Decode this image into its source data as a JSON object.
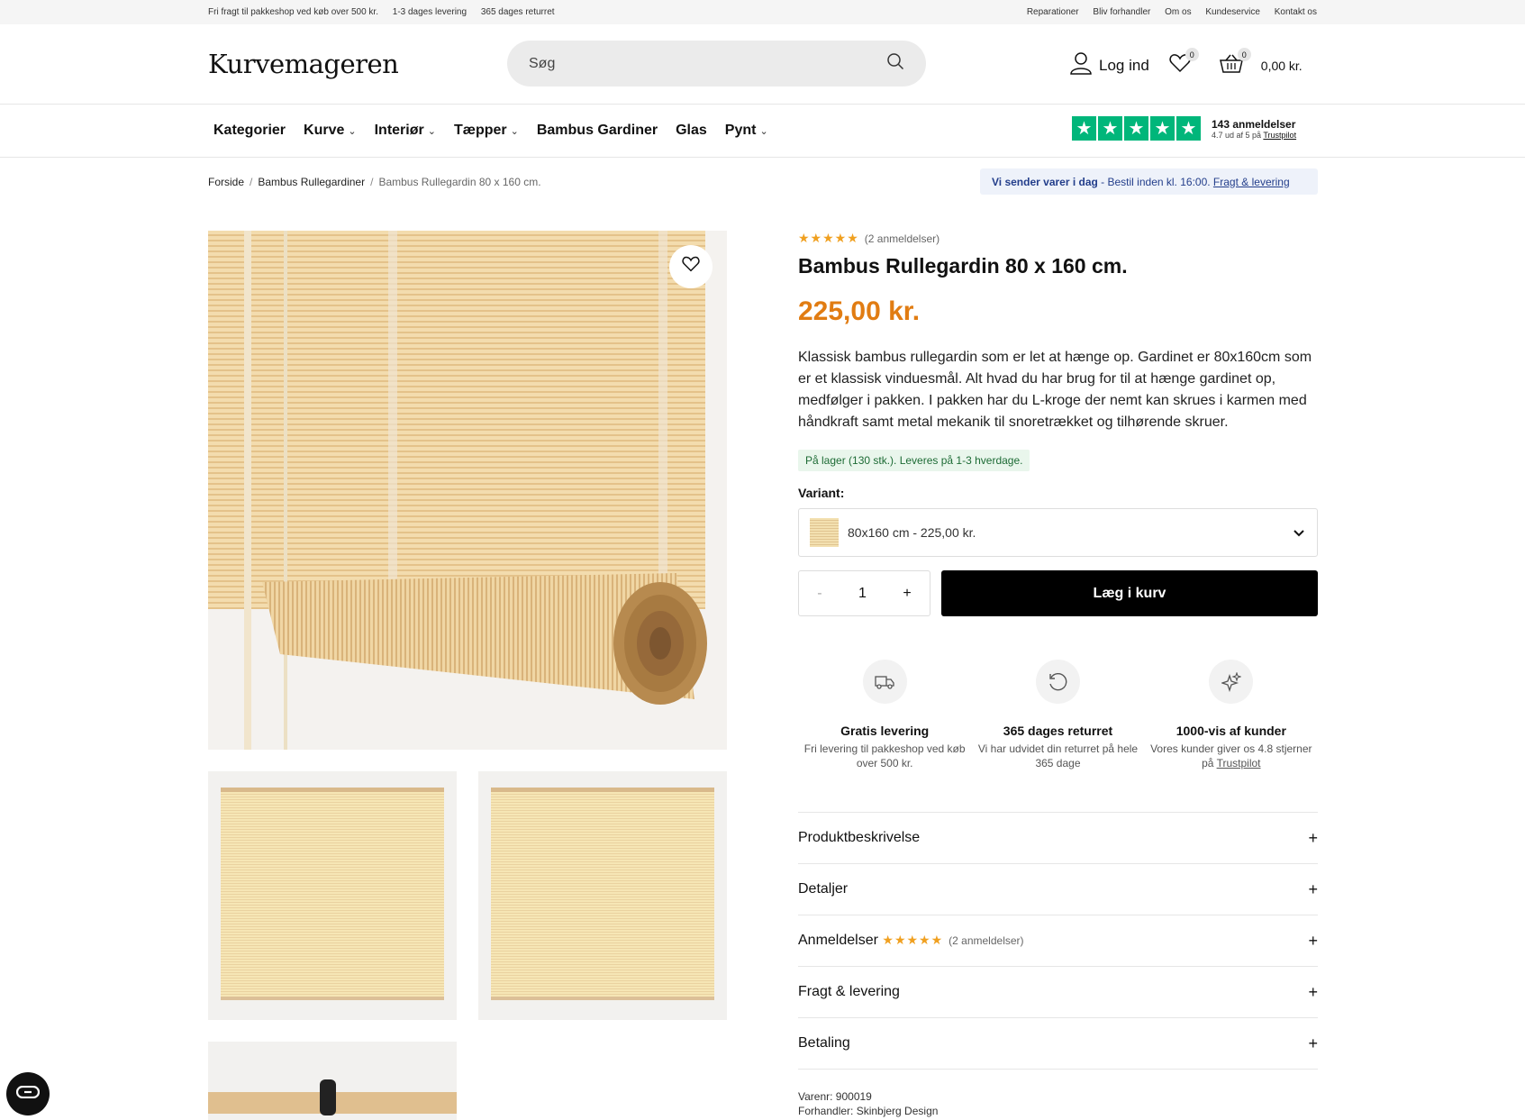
{
  "topbar": {
    "left": [
      "Fri fragt til pakkeshop ved køb over 500 kr.",
      "1-3 dages levering",
      "365 dages returret"
    ],
    "right": [
      "Reparationer",
      "Bliv forhandler",
      "Om os",
      "Kundeservice",
      "Kontakt os"
    ]
  },
  "header": {
    "logo": "Kurvemageren",
    "search_placeholder": "Søg",
    "login": "Log ind",
    "wishlist_count": "0",
    "cart_count": "0",
    "cart_total": "0,00 kr."
  },
  "nav": {
    "items": [
      {
        "label": "Kategorier",
        "chev": ""
      },
      {
        "label": "Kurve",
        "chev": "⌄"
      },
      {
        "label": "Interiør",
        "chev": "⌄"
      },
      {
        "label": "Tæpper",
        "chev": "⌄"
      },
      {
        "label": "Bambus Gardiner",
        "chev": ""
      },
      {
        "label": "Glas",
        "chev": ""
      },
      {
        "label": "Pynt",
        "chev": "⌄"
      }
    ],
    "trustpilot": {
      "reviews": "143 anmeldelser",
      "score_text": "4.7 ud af 5 på",
      "link": "Trustpilot"
    }
  },
  "breadcrumb": [
    "Forside",
    "Bambus Rullegardiner",
    "Bambus Rullegardin 80 x 160 cm."
  ],
  "shipping_notice": {
    "bold": "Vi sender varer i dag",
    "text": " - Bestil inden kl. 16:00. ",
    "link": "Fragt & levering"
  },
  "product": {
    "rating_stars": "★★★★★",
    "review_count": "(2 anmeldelser)",
    "title": "Bambus Rullegardin 80 x 160 cm.",
    "price": "225,00 kr.",
    "description": "Klassisk bambus rullegardin som er let at hænge op. Gardinet er 80x160cm som er et klassisk vinduesmål. Alt hvad du har brug for til at hænge gardinet op, medfølger i pakken. I pakken har du L-kroge der nemt kan skrues i karmen med håndkraft samt metal mekanik til snoretrækket og tilhørende skruer.",
    "stock": "På lager (130 stk.). Leveres på 1-3 hverdage.",
    "variant_label": "Variant:",
    "variant_selected": "80x160 cm - 225,00 kr.",
    "qty_minus": "-",
    "qty": "1",
    "qty_plus": "+",
    "add_to_cart": "Læg i kurv"
  },
  "usps": [
    {
      "title": "Gratis levering",
      "desc": "Fri levering til pakkeshop ved køb over 500 kr.",
      "icon": "truck-icon"
    },
    {
      "title": "365 dages returret",
      "desc": "Vi har udvidet din returret på hele 365 dage",
      "icon": "return-icon"
    },
    {
      "title": "1000-vis af kunder",
      "desc": "Vores kunder giver os 4.8 stjerner på ",
      "link": "Trustpilot",
      "icon": "sparkle-icon"
    }
  ],
  "accordion": [
    {
      "label": "Produktbeskrivelse"
    },
    {
      "label": "Detaljer"
    },
    {
      "label": "Anmeldelser",
      "stars": "★★★★★",
      "count": "(2 anmeldelser)"
    },
    {
      "label": "Fragt & levering"
    },
    {
      "label": "Betaling"
    }
  ],
  "meta": {
    "sku": "Varenr: 900019",
    "vendor": "Forhandler: Skinbjerg Design"
  },
  "colors": {
    "accent_price": "#e17c12",
    "trustpilot": "#00b67a",
    "button": "#000000"
  }
}
